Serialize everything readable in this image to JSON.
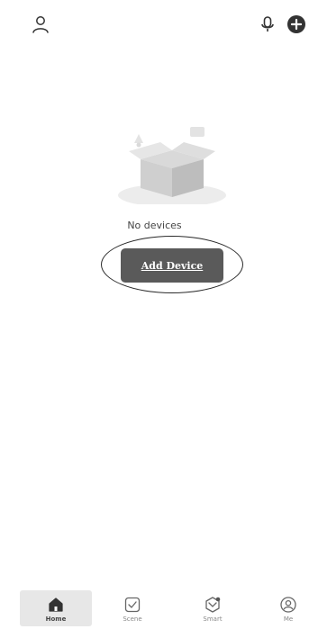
{
  "header": {
    "profile_icon": "profile-icon",
    "mic_icon": "microphone-icon",
    "add_icon": "add-circle-icon"
  },
  "empty_state": {
    "message": "No devices",
    "add_button_label": "Add Device"
  },
  "tabbar": {
    "tabs": [
      {
        "label": "Home",
        "icon": "home-icon",
        "active": true
      },
      {
        "label": "Scene",
        "icon": "checkbox-icon",
        "active": false
      },
      {
        "label": "Smart",
        "icon": "smart-hexagon-icon",
        "active": false
      },
      {
        "label": "Me",
        "icon": "user-circle-icon",
        "active": false
      }
    ]
  },
  "colors": {
    "button_bg": "#5a5a5a",
    "active_tab_bg": "#e7e7e7"
  }
}
